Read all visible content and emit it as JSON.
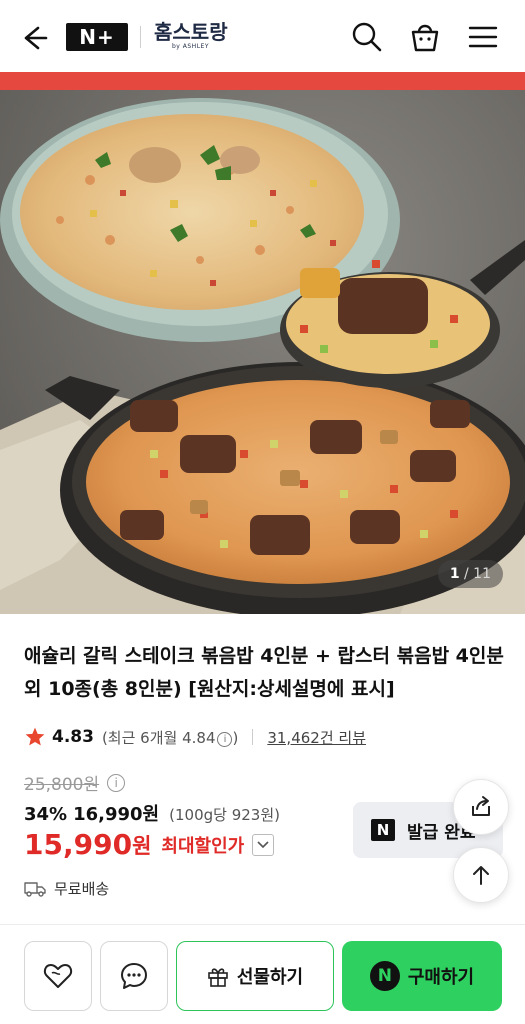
{
  "header": {
    "logo": "N+",
    "brand": "홈스토랑",
    "brand_sub": "by ASHLEY"
  },
  "gallery": {
    "current": "1",
    "total": "/ 11"
  },
  "product": {
    "title": "애슐리 갈릭 스테이크 볶음밥 4인분 + 랍스터 볶음밥 4인분 외 10종(총 8인분) [원산지:상세설명에 표시]",
    "rating": "4.83",
    "recent_rating": "(최근 6개월 4.84",
    "recent_close": ")",
    "reviews": "31,462건 리뷰",
    "original_price": "25,800원",
    "discount_pct": "34%",
    "discount_price": "16,990원",
    "unit_price": "(100g당 923원)",
    "final_price": "15,990",
    "final_won": "원",
    "final_label": "최대할인가",
    "shipping": "무료배송"
  },
  "coupon": {
    "badge": "N",
    "label": "발급 완료"
  },
  "actions": {
    "gift": "선물하기",
    "buy_badge": "N",
    "buy": "구매하기"
  },
  "colors": {
    "accent_red": "#e5483e",
    "price_red": "#e02a27",
    "buy_green": "#2ed15f",
    "star": "#e8462f"
  }
}
